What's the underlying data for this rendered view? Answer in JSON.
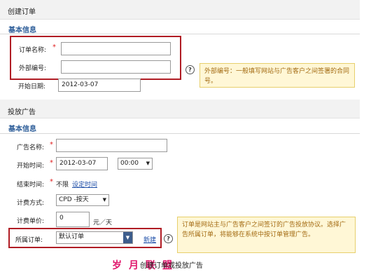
{
  "order_section": {
    "title": "创建订单",
    "subtitle": "基本信息",
    "order_name_label": "订单名称:",
    "order_name_value": "",
    "external_no_label": "外部编号:",
    "external_no_value": "",
    "start_date_label": "开始日期:",
    "start_date_value": "2012-03-07",
    "help_symbol": "?",
    "tip_external_no": "外部编号：一般填写网站与广告客户之间签署的合同号。"
  },
  "ad_section": {
    "title": "投放广告",
    "subtitle": "基本信息",
    "ad_name_label": "广告名称:",
    "ad_name_value": "",
    "start_time_label": "开始时间:",
    "start_date_value": "2012-03-07",
    "start_hour_value": "00:00",
    "end_time_label": "结束时间:",
    "end_unlimited_text": "不限",
    "set_time_link": "设定时间",
    "billing_label": "计费方式:",
    "billing_value": "CPD  -按天",
    "unit_price_label": "计费单价:",
    "unit_price_value": "0",
    "unit_price_unit": "元／天",
    "order_label": "所属订单:",
    "order_value": "默认订单",
    "new_link": "新建",
    "help_symbol": "?",
    "tip_order": "订单是网站主与广告客户之间签订的广告投放协议。选择广告所属订单，将能够在系统中按订单管理广告。"
  },
  "footer": {
    "watermark": "岁月联盟",
    "caption": "创建订单或投放广告"
  }
}
